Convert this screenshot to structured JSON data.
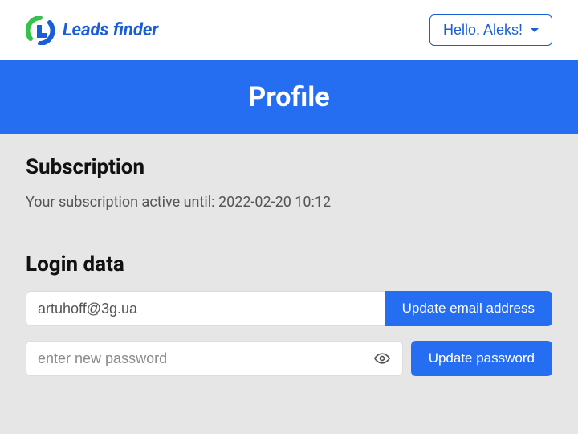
{
  "header": {
    "brand": "Leads finder",
    "user_greeting": "Hello, Aleks!"
  },
  "banner": {
    "title": "Profile"
  },
  "subscription": {
    "heading": "Subscription",
    "status_text": "Your subscription active until: 2022-02-20 10:12"
  },
  "login": {
    "heading": "Login data",
    "email_value": "artuhoff@3g.ua",
    "update_email_label": "Update email address",
    "password_placeholder": "enter new password",
    "update_password_label": "Update password"
  }
}
